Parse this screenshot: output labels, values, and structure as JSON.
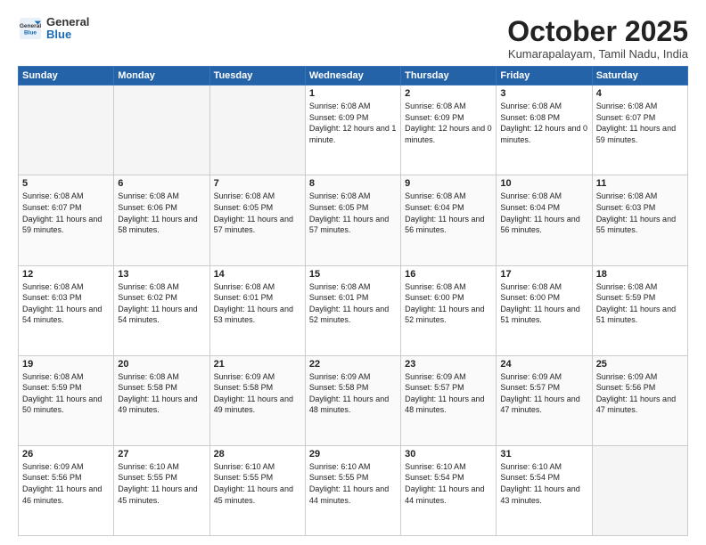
{
  "header": {
    "logo_general": "General",
    "logo_blue": "Blue",
    "month": "October 2025",
    "location": "Kumarapalayam, Tamil Nadu, India"
  },
  "days_of_week": [
    "Sunday",
    "Monday",
    "Tuesday",
    "Wednesday",
    "Thursday",
    "Friday",
    "Saturday"
  ],
  "weeks": [
    [
      {
        "day": "",
        "info": ""
      },
      {
        "day": "",
        "info": ""
      },
      {
        "day": "",
        "info": ""
      },
      {
        "day": "1",
        "info": "Sunrise: 6:08 AM\nSunset: 6:09 PM\nDaylight: 12 hours\nand 1 minute."
      },
      {
        "day": "2",
        "info": "Sunrise: 6:08 AM\nSunset: 6:09 PM\nDaylight: 12 hours\nand 0 minutes."
      },
      {
        "day": "3",
        "info": "Sunrise: 6:08 AM\nSunset: 6:08 PM\nDaylight: 12 hours\nand 0 minutes."
      },
      {
        "day": "4",
        "info": "Sunrise: 6:08 AM\nSunset: 6:07 PM\nDaylight: 11 hours\nand 59 minutes."
      }
    ],
    [
      {
        "day": "5",
        "info": "Sunrise: 6:08 AM\nSunset: 6:07 PM\nDaylight: 11 hours\nand 59 minutes."
      },
      {
        "day": "6",
        "info": "Sunrise: 6:08 AM\nSunset: 6:06 PM\nDaylight: 11 hours\nand 58 minutes."
      },
      {
        "day": "7",
        "info": "Sunrise: 6:08 AM\nSunset: 6:05 PM\nDaylight: 11 hours\nand 57 minutes."
      },
      {
        "day": "8",
        "info": "Sunrise: 6:08 AM\nSunset: 6:05 PM\nDaylight: 11 hours\nand 57 minutes."
      },
      {
        "day": "9",
        "info": "Sunrise: 6:08 AM\nSunset: 6:04 PM\nDaylight: 11 hours\nand 56 minutes."
      },
      {
        "day": "10",
        "info": "Sunrise: 6:08 AM\nSunset: 6:04 PM\nDaylight: 11 hours\nand 56 minutes."
      },
      {
        "day": "11",
        "info": "Sunrise: 6:08 AM\nSunset: 6:03 PM\nDaylight: 11 hours\nand 55 minutes."
      }
    ],
    [
      {
        "day": "12",
        "info": "Sunrise: 6:08 AM\nSunset: 6:03 PM\nDaylight: 11 hours\nand 54 minutes."
      },
      {
        "day": "13",
        "info": "Sunrise: 6:08 AM\nSunset: 6:02 PM\nDaylight: 11 hours\nand 54 minutes."
      },
      {
        "day": "14",
        "info": "Sunrise: 6:08 AM\nSunset: 6:01 PM\nDaylight: 11 hours\nand 53 minutes."
      },
      {
        "day": "15",
        "info": "Sunrise: 6:08 AM\nSunset: 6:01 PM\nDaylight: 11 hours\nand 52 minutes."
      },
      {
        "day": "16",
        "info": "Sunrise: 6:08 AM\nSunset: 6:00 PM\nDaylight: 11 hours\nand 52 minutes."
      },
      {
        "day": "17",
        "info": "Sunrise: 6:08 AM\nSunset: 6:00 PM\nDaylight: 11 hours\nand 51 minutes."
      },
      {
        "day": "18",
        "info": "Sunrise: 6:08 AM\nSunset: 5:59 PM\nDaylight: 11 hours\nand 51 minutes."
      }
    ],
    [
      {
        "day": "19",
        "info": "Sunrise: 6:08 AM\nSunset: 5:59 PM\nDaylight: 11 hours\nand 50 minutes."
      },
      {
        "day": "20",
        "info": "Sunrise: 6:08 AM\nSunset: 5:58 PM\nDaylight: 11 hours\nand 49 minutes."
      },
      {
        "day": "21",
        "info": "Sunrise: 6:09 AM\nSunset: 5:58 PM\nDaylight: 11 hours\nand 49 minutes."
      },
      {
        "day": "22",
        "info": "Sunrise: 6:09 AM\nSunset: 5:58 PM\nDaylight: 11 hours\nand 48 minutes."
      },
      {
        "day": "23",
        "info": "Sunrise: 6:09 AM\nSunset: 5:57 PM\nDaylight: 11 hours\nand 48 minutes."
      },
      {
        "day": "24",
        "info": "Sunrise: 6:09 AM\nSunset: 5:57 PM\nDaylight: 11 hours\nand 47 minutes."
      },
      {
        "day": "25",
        "info": "Sunrise: 6:09 AM\nSunset: 5:56 PM\nDaylight: 11 hours\nand 47 minutes."
      }
    ],
    [
      {
        "day": "26",
        "info": "Sunrise: 6:09 AM\nSunset: 5:56 PM\nDaylight: 11 hours\nand 46 minutes."
      },
      {
        "day": "27",
        "info": "Sunrise: 6:10 AM\nSunset: 5:55 PM\nDaylight: 11 hours\nand 45 minutes."
      },
      {
        "day": "28",
        "info": "Sunrise: 6:10 AM\nSunset: 5:55 PM\nDaylight: 11 hours\nand 45 minutes."
      },
      {
        "day": "29",
        "info": "Sunrise: 6:10 AM\nSunset: 5:55 PM\nDaylight: 11 hours\nand 44 minutes."
      },
      {
        "day": "30",
        "info": "Sunrise: 6:10 AM\nSunset: 5:54 PM\nDaylight: 11 hours\nand 44 minutes."
      },
      {
        "day": "31",
        "info": "Sunrise: 6:10 AM\nSunset: 5:54 PM\nDaylight: 11 hours\nand 43 minutes."
      },
      {
        "day": "",
        "info": ""
      }
    ]
  ]
}
